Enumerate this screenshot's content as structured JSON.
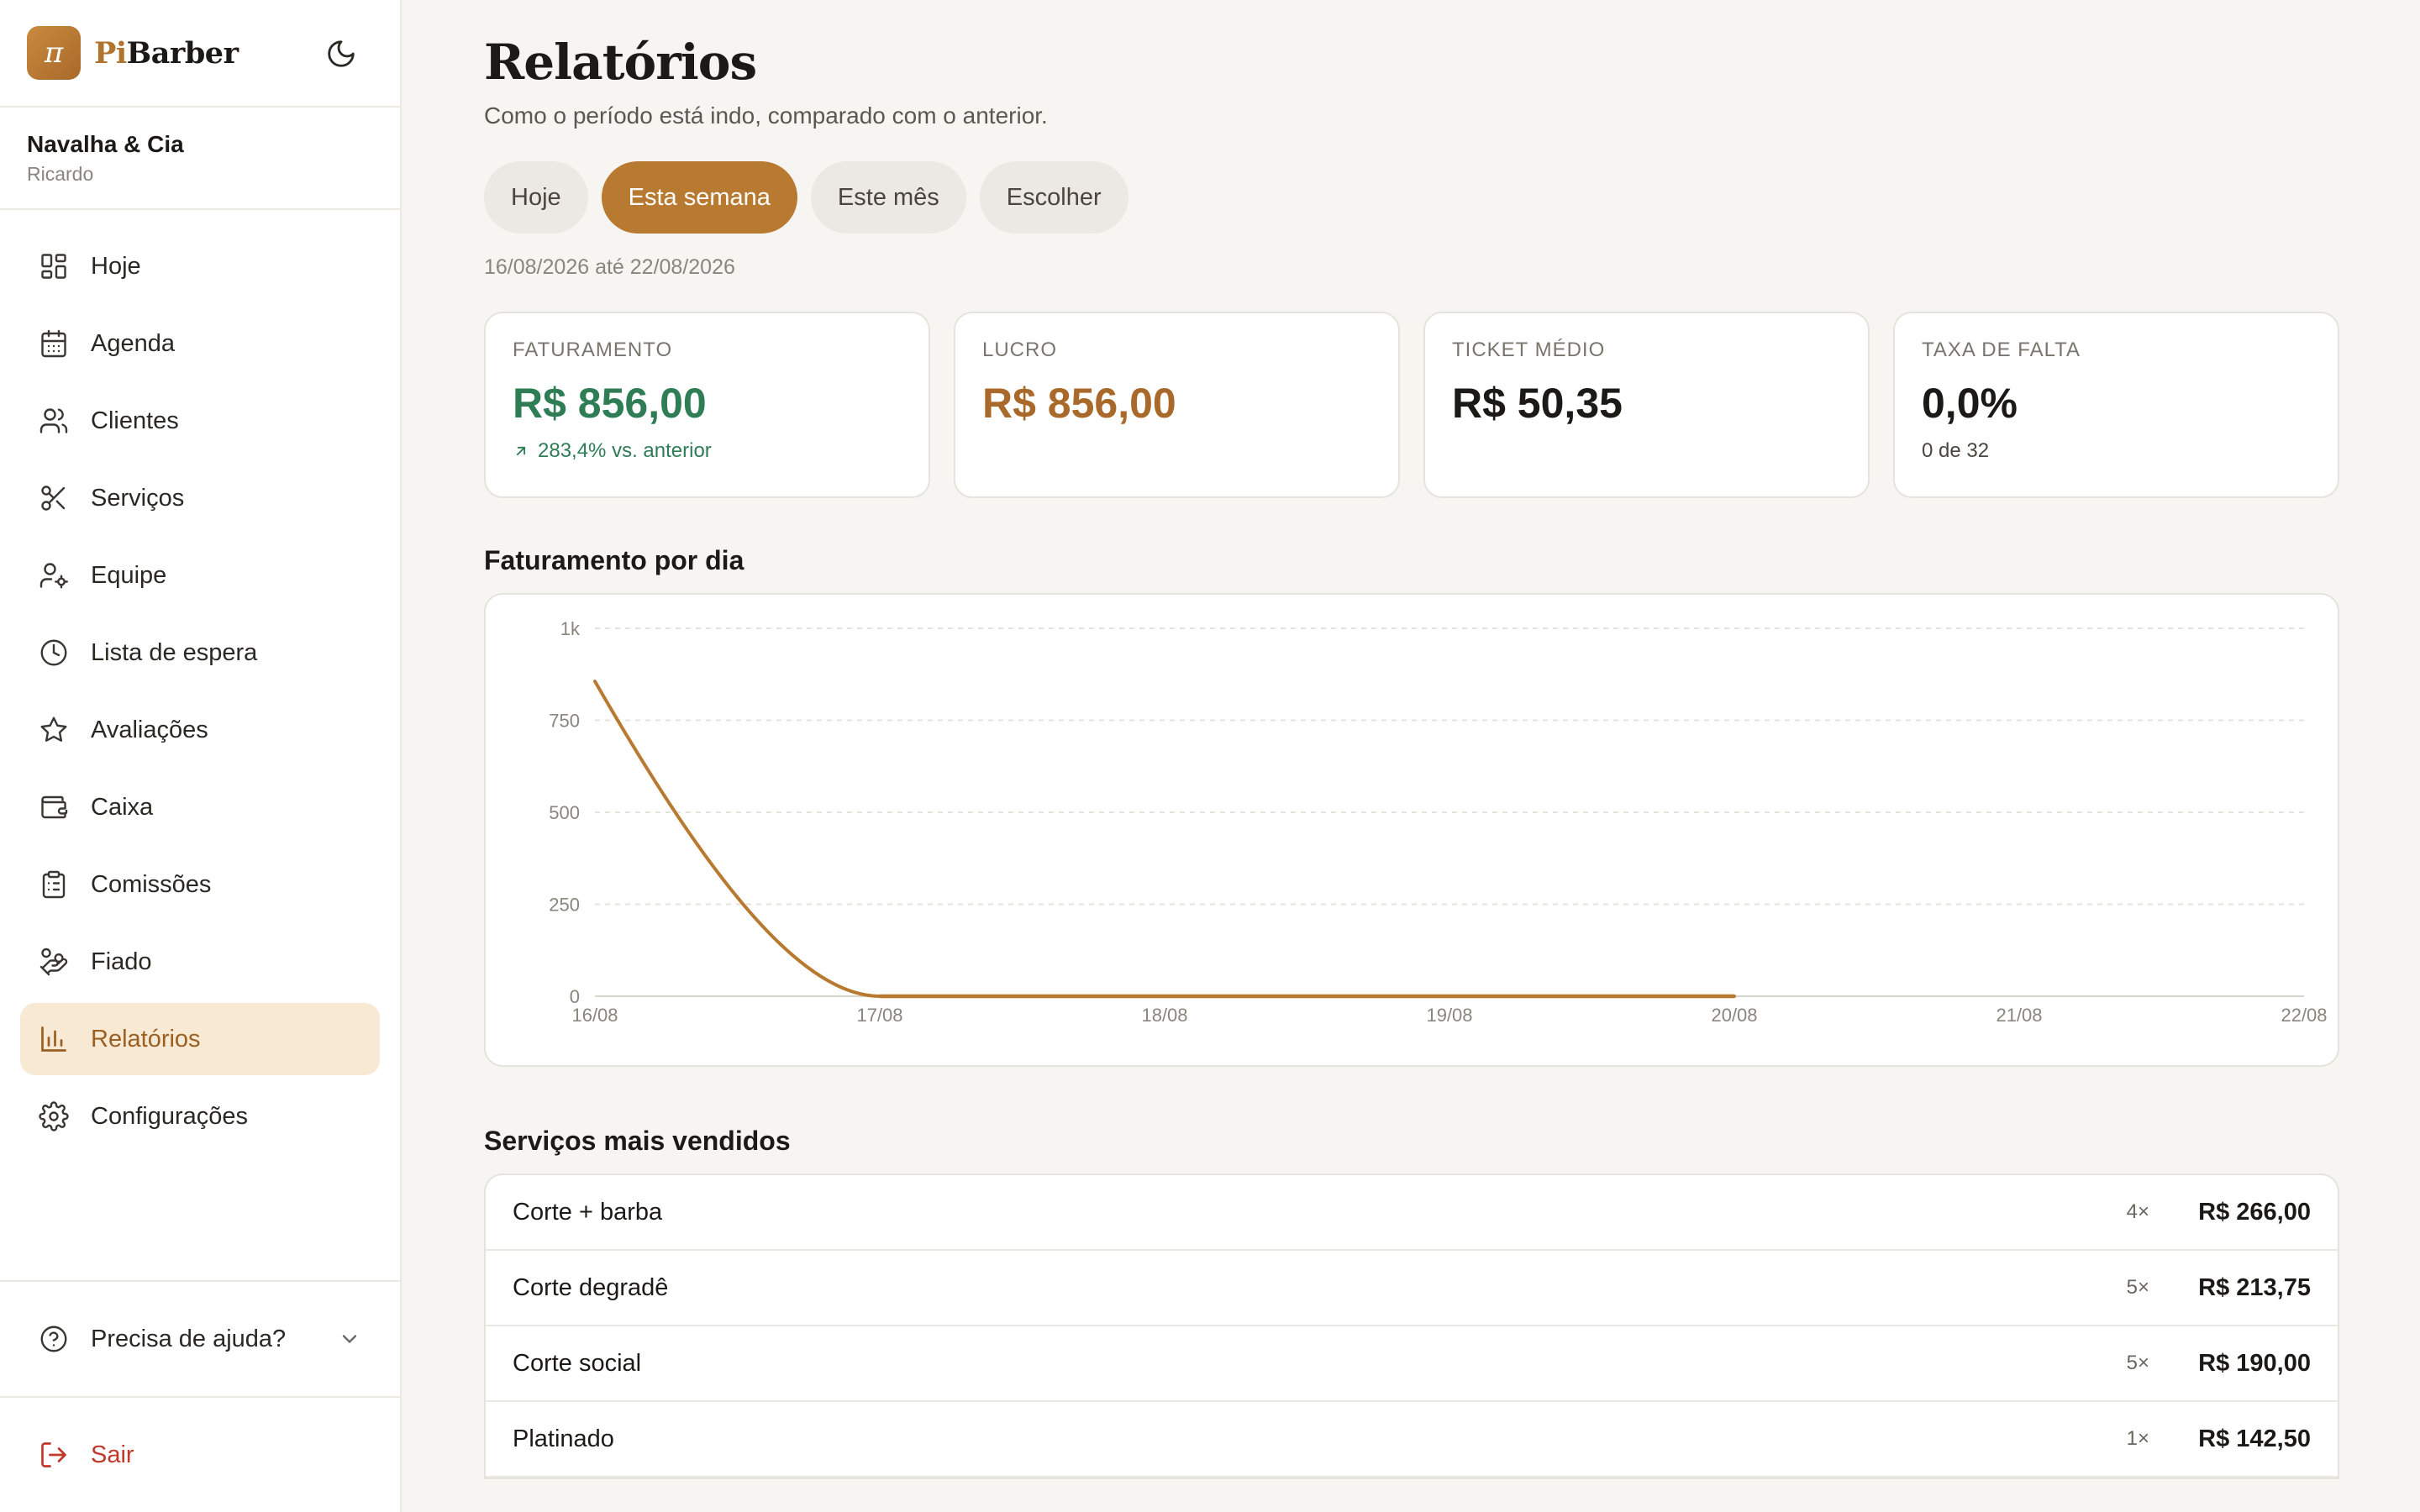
{
  "brand": {
    "logo_glyph": "π",
    "name_prefix": "Pi",
    "name_suffix": "Barber",
    "accent": "#b87a30"
  },
  "shop": {
    "name": "Navalha & Cia",
    "user": "Ricardo"
  },
  "sidebar": {
    "items": [
      {
        "label": "Hoje",
        "icon": "dashboard-icon"
      },
      {
        "label": "Agenda",
        "icon": "calendar-icon"
      },
      {
        "label": "Clientes",
        "icon": "users-icon"
      },
      {
        "label": "Serviços",
        "icon": "scissors-icon"
      },
      {
        "label": "Equipe",
        "icon": "user-cog-icon"
      },
      {
        "label": "Lista de espera",
        "icon": "clock-icon"
      },
      {
        "label": "Avaliações",
        "icon": "star-icon"
      },
      {
        "label": "Caixa",
        "icon": "wallet-icon"
      },
      {
        "label": "Comissões",
        "icon": "clipboard-icon"
      },
      {
        "label": "Fiado",
        "icon": "hand-coins-icon"
      },
      {
        "label": "Relatórios",
        "icon": "bar-chart-icon",
        "active": true
      },
      {
        "label": "Configurações",
        "icon": "gear-icon"
      }
    ],
    "help_label": "Precisa de ajuda?",
    "logout_label": "Sair"
  },
  "page": {
    "title": "Relatórios",
    "subtitle": "Como o período está indo, comparado com o anterior.",
    "tabs": [
      {
        "label": "Hoje",
        "active": false
      },
      {
        "label": "Esta semana",
        "active": true
      },
      {
        "label": "Este mês",
        "active": false
      },
      {
        "label": "Escolher",
        "active": false
      }
    ],
    "range": "16/08/2026 até 22/08/2026"
  },
  "cards": [
    {
      "label": "FATURAMENTO",
      "value": "R$ 856,00",
      "note": "283,4% vs. anterior"
    },
    {
      "label": "LUCRO",
      "value": "R$ 856,00",
      "note": ""
    },
    {
      "label": "TICKET MÉDIO",
      "value": "R$ 50,35",
      "note": ""
    },
    {
      "label": "TAXA DE FALTA",
      "value": "0,0%",
      "note": "0 de 32"
    }
  ],
  "chart": {
    "title": "Faturamento por dia"
  },
  "chart_data": {
    "type": "line",
    "categories": [
      "16/08",
      "17/08",
      "18/08",
      "19/08",
      "20/08",
      "21/08",
      "22/08"
    ],
    "series": [
      {
        "values": [
          856,
          0,
          0,
          0,
          0
        ]
      }
    ],
    "y_ticks": [
      0,
      250,
      500,
      750,
      1000
    ],
    "y_tick_labels": [
      "0",
      "250",
      "500",
      "750",
      "1k"
    ],
    "ylim": [
      0,
      1000
    ],
    "grid": true,
    "color": "#b87a30"
  },
  "services": {
    "title": "Serviços mais vendidos",
    "rows": [
      {
        "name": "Corte + barba",
        "qty": "4×",
        "amount": "R$ 266,00"
      },
      {
        "name": "Corte degradê",
        "qty": "5×",
        "amount": "R$ 213,75"
      },
      {
        "name": "Corte social",
        "qty": "5×",
        "amount": "R$ 190,00"
      },
      {
        "name": "Platinado",
        "qty": "1×",
        "amount": "R$ 142,50"
      }
    ]
  }
}
